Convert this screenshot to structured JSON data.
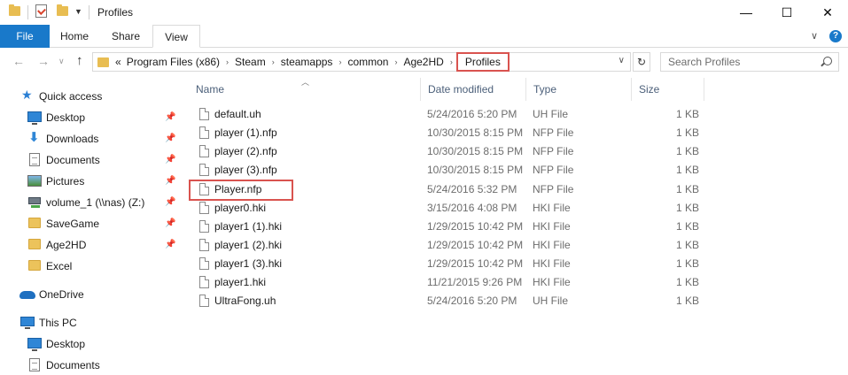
{
  "window": {
    "title": "Profiles",
    "controls": {
      "minimize": "—",
      "maximize": "☐",
      "close": "✕"
    }
  },
  "ribbon": {
    "tabs": [
      {
        "label": "File"
      },
      {
        "label": "Home"
      },
      {
        "label": "Share"
      },
      {
        "label": "View"
      }
    ],
    "expand_glyph": "∨",
    "help_glyph": "?"
  },
  "address": {
    "overflow": "«",
    "crumbs": [
      "Program Files (x86)",
      "Steam",
      "steamapps",
      "common",
      "Age2HD"
    ],
    "current": "Profiles",
    "separator": "›"
  },
  "search": {
    "placeholder": "Search Profiles"
  },
  "nav_pane": {
    "quick_access": "Quick access",
    "pinned": [
      {
        "label": "Desktop",
        "icon": "desktop-icon",
        "pinned": true
      },
      {
        "label": "Downloads",
        "icon": "downloads-icon",
        "pinned": true
      },
      {
        "label": "Documents",
        "icon": "documents-icon",
        "pinned": true
      },
      {
        "label": "Pictures",
        "icon": "pictures-icon",
        "pinned": true
      },
      {
        "label": "volume_1 (\\\\nas) (Z:)",
        "icon": "network-drive-icon",
        "pinned": true
      },
      {
        "label": "SaveGame",
        "icon": "folder-icon",
        "pinned": true
      },
      {
        "label": "Age2HD",
        "icon": "folder-icon",
        "pinned": true
      },
      {
        "label": "Excel",
        "icon": "folder-icon",
        "pinned": false
      }
    ],
    "onedrive": "OneDrive",
    "this_pc": "This PC",
    "this_pc_items": [
      {
        "label": "Desktop",
        "icon": "desktop-icon"
      },
      {
        "label": "Documents",
        "icon": "documents-icon"
      }
    ]
  },
  "columns": {
    "name": "Name",
    "date": "Date modified",
    "type": "Type",
    "size": "Size"
  },
  "files": [
    {
      "name": "default.uh",
      "date": "5/24/2016 5:20 PM",
      "type": "UH File",
      "size": "1 KB"
    },
    {
      "name": "player (1).nfp",
      "date": "10/30/2015 8:15 PM",
      "type": "NFP File",
      "size": "1 KB"
    },
    {
      "name": "player (2).nfp",
      "date": "10/30/2015 8:15 PM",
      "type": "NFP File",
      "size": "1 KB"
    },
    {
      "name": "player (3).nfp",
      "date": "10/30/2015 8:15 PM",
      "type": "NFP File",
      "size": "1 KB"
    },
    {
      "name": "Player.nfp",
      "date": "5/24/2016 5:32 PM",
      "type": "NFP File",
      "size": "1 KB"
    },
    {
      "name": "player0.hki",
      "date": "3/15/2016 4:08 PM",
      "type": "HKI File",
      "size": "1 KB"
    },
    {
      "name": "player1 (1).hki",
      "date": "1/29/2015 10:42 PM",
      "type": "HKI File",
      "size": "1 KB"
    },
    {
      "name": "player1 (2).hki",
      "date": "1/29/2015 10:42 PM",
      "type": "HKI File",
      "size": "1 KB"
    },
    {
      "name": "player1 (3).hki",
      "date": "1/29/2015 10:42 PM",
      "type": "HKI File",
      "size": "1 KB"
    },
    {
      "name": "player1.hki",
      "date": "11/21/2015 9:26 PM",
      "type": "HKI File",
      "size": "1 KB"
    },
    {
      "name": "UltraFong.uh",
      "date": "5/24/2016 5:20 PM",
      "type": "UH File",
      "size": "1 KB"
    }
  ],
  "colors": {
    "accent": "#1979ca",
    "highlight": "#d9534f",
    "folder": "#e8bd52"
  }
}
